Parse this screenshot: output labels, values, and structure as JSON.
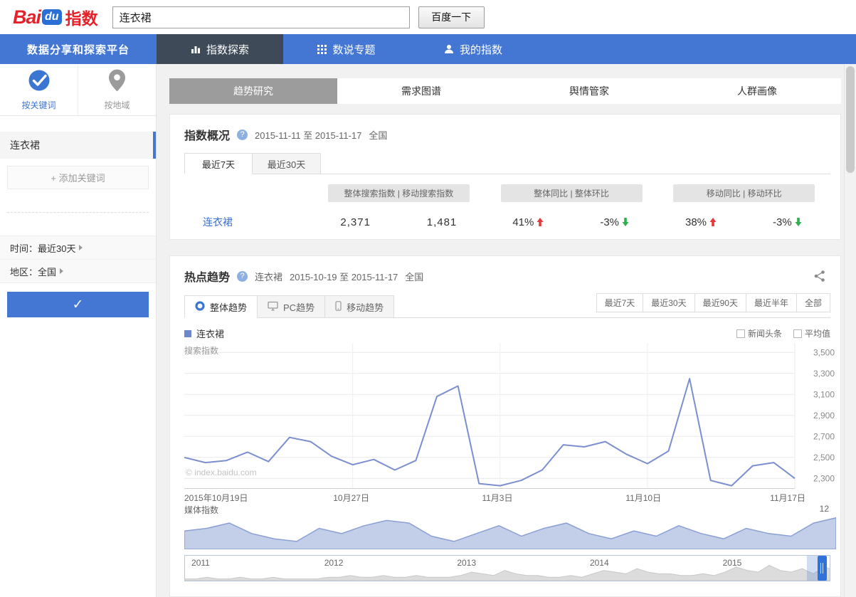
{
  "header": {
    "logo_bai": "Bai",
    "logo_du": "du",
    "logo_suffix": "指数",
    "search_value": "连衣裙",
    "search_button": "百度一下"
  },
  "nav": {
    "platform": "数据分享和探索平台",
    "tabs": [
      {
        "label": "指数探索",
        "icon": "bar-chart-icon",
        "active": true
      },
      {
        "label": "数说专题",
        "icon": "grid-icon",
        "active": false
      },
      {
        "label": "我的指数",
        "icon": "user-icon",
        "active": false
      }
    ]
  },
  "sidebar": {
    "mode_keyword": "按关键词",
    "mode_region": "按地域",
    "keyword_item": "连衣裙",
    "add_keyword": "+ 添加关键词",
    "time_filter": "时间：最近30天",
    "region_filter": "地区：全国",
    "confirm_check": "✓"
  },
  "main": {
    "tabs": [
      "趋势研究",
      "需求图谱",
      "舆情管家",
      "人群画像"
    ],
    "overview": {
      "title": "指数概况",
      "date_range": "2015-11-11 至 2015-11-17",
      "region": "全国",
      "tab_7d": "最近7天",
      "tab_30d": "最近30天",
      "header_search": "整体搜索指数  |  移动搜索指数",
      "header_overall": "整体同比  |  整体环比",
      "header_mobile": "移动同比  |  移动环比",
      "row": {
        "keyword": "连衣裙",
        "overall_index": "2,371",
        "mobile_index": "1,481",
        "overall_yoy": "41%",
        "overall_mom": "-3%",
        "mobile_yoy": "38%",
        "mobile_mom": "-3%"
      }
    },
    "trend": {
      "title": "热点趋势",
      "keyword": "连衣裙",
      "date_range": "2015-10-19 至 2015-11-17",
      "region": "全国",
      "tab_overall": "整体趋势",
      "tab_pc": "PC趋势",
      "tab_mobile": "移动趋势",
      "ranges": [
        "最近7天",
        "最近30天",
        "最近90天",
        "最近半年",
        "全部"
      ],
      "legend_keyword": "连衣裙",
      "cb_news": "新闻头条",
      "cb_avg": "平均值",
      "watermark": "© index.baidu.com"
    }
  },
  "colors": {
    "accent_blue": "#4377d3",
    "nav_active": "#3e4a58",
    "line_blue": "#7b8fd0",
    "up_red": "#e4393c",
    "down_green": "#2fae4d"
  },
  "chart_data": [
    {
      "type": "line",
      "title": "热点趋势 - 整体趋势",
      "ylabel": "搜索指数",
      "x_tick_labels": [
        "2015年10月19日",
        "10月27日",
        "11月3日",
        "11月10日",
        "11月17日"
      ],
      "x_tick_positions": [
        0,
        8,
        15,
        22,
        29
      ],
      "y_ticks": [
        3500,
        3300,
        3100,
        2900,
        2700,
        2500,
        2300
      ],
      "y_range": [
        2200,
        3590
      ],
      "grid": true,
      "legend_position": "top-left",
      "series": [
        {
          "name": "连衣裙",
          "color": "#7b8fd0",
          "values": [
            2500,
            2450,
            2470,
            2550,
            2460,
            2690,
            2650,
            2510,
            2430,
            2480,
            2380,
            2470,
            3080,
            3180,
            2250,
            2230,
            2280,
            2380,
            2620,
            2600,
            2650,
            2530,
            2440,
            2560,
            3250,
            2280,
            2230,
            2420,
            2450,
            2300
          ]
        }
      ]
    },
    {
      "type": "area",
      "title": "媒体指数",
      "y_max_label": "12",
      "y_range": [
        0,
        13
      ],
      "fill": "#c3cfe9",
      "stroke": "#8aa0d4",
      "values": [
        7,
        8,
        10,
        6,
        4,
        3,
        8,
        6,
        9,
        11,
        10,
        5,
        3,
        6,
        9,
        5,
        8,
        10,
        6,
        4,
        7,
        5,
        9,
        6,
        4,
        8,
        6,
        5,
        10,
        12
      ]
    },
    {
      "type": "area",
      "title": "历史缩略图",
      "x_tick_labels": [
        "2011",
        "2012",
        "2013",
        "2014",
        "2015"
      ],
      "y_range": [
        0,
        10
      ],
      "fill": "#dcdcdc",
      "stroke": "#c8c8c8",
      "values": [
        1,
        1,
        2,
        1,
        1,
        2,
        1,
        1,
        2,
        1,
        1,
        1,
        1,
        2,
        2,
        3,
        2,
        2,
        3,
        2,
        2,
        3,
        2,
        2,
        2,
        3,
        5,
        4,
        3,
        6,
        4,
        3,
        3,
        2,
        2,
        3,
        2,
        4,
        6,
        5,
        4,
        7,
        5,
        4,
        4,
        3,
        3,
        4,
        3,
        5,
        8,
        6,
        5,
        9,
        6,
        5,
        7,
        4,
        8,
        6
      ]
    }
  ]
}
